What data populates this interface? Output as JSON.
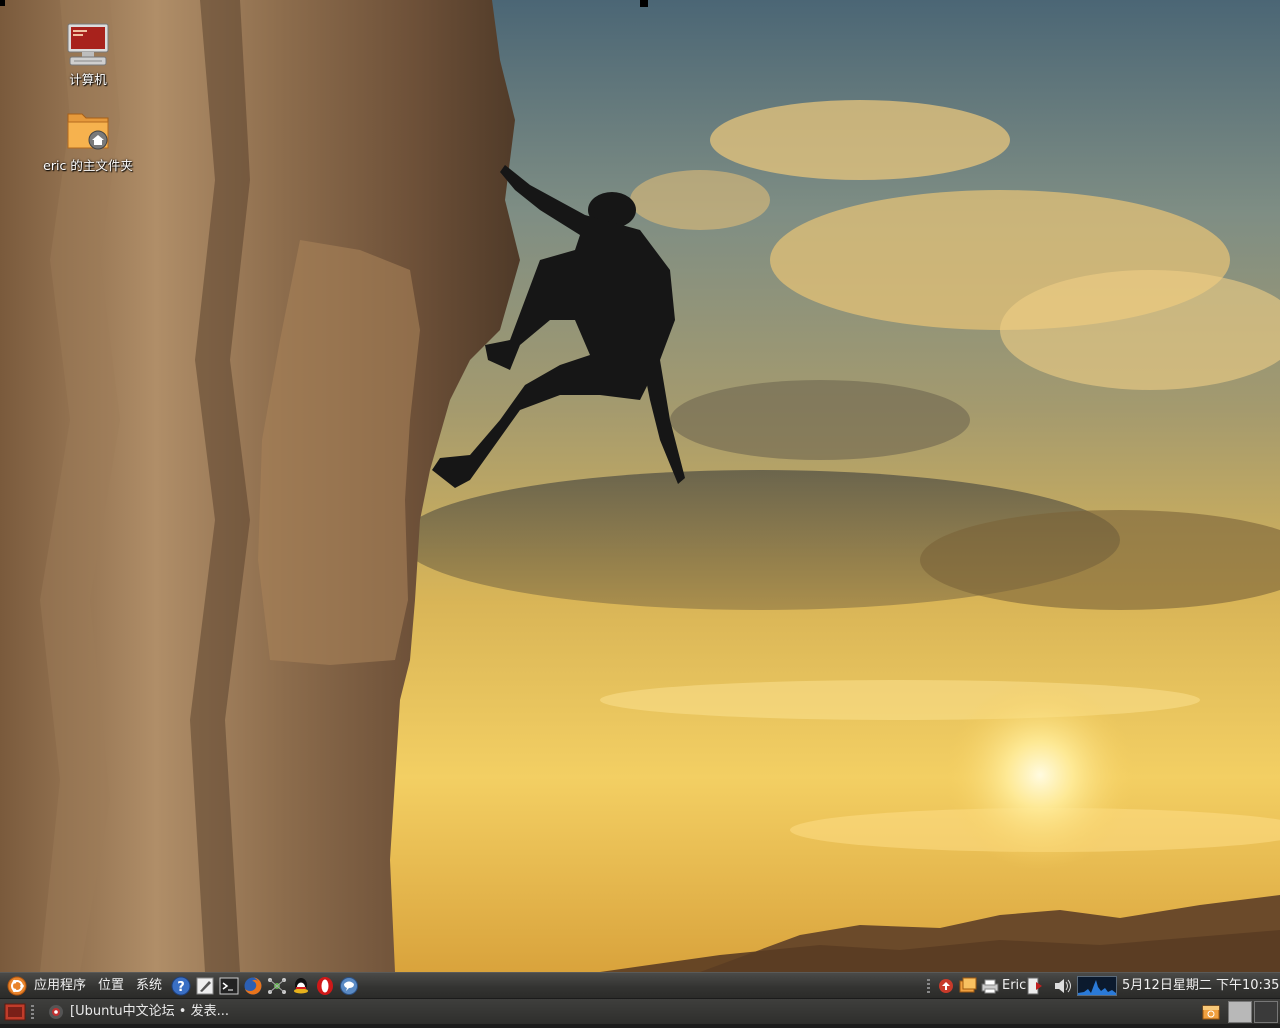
{
  "desktop": {
    "icons": [
      {
        "label": "计算机",
        "icon": "computer-icon"
      },
      {
        "label": "eric 的主文件夹",
        "icon": "home-folder-icon"
      }
    ]
  },
  "top_panel": {
    "main_menu_icon": "ubuntu-logo-icon",
    "menus": [
      "应用程序",
      "位置",
      "系统"
    ],
    "launchers": [
      "help-icon",
      "text-editor-icon",
      "terminal-icon",
      "firefox-icon",
      "network-icon",
      "qq-icon",
      "opera-icon",
      "chat-icon"
    ],
    "tray_icons": [
      "update-notifier-icon",
      "folder-window-icon",
      "printer-icon",
      "shutdown-icon",
      "volume-icon",
      "system-monitor-icon"
    ],
    "user": "Eric",
    "clock": "5月12日星期二 下午10:35"
  },
  "bottom_panel": {
    "show_desktop_icon": "show-desktop-icon",
    "task": {
      "label": "[Ubuntu中文论坛 • 发表...",
      "icon": "browser-window-icon"
    },
    "trash_icon": "trash-icon",
    "workspaces": [
      "1",
      "2"
    ]
  },
  "colors": {
    "sky_top": "#4e6a78",
    "sunset": "#f2c14a",
    "rock": "#8a6a48",
    "panel": "#3a3a38"
  }
}
